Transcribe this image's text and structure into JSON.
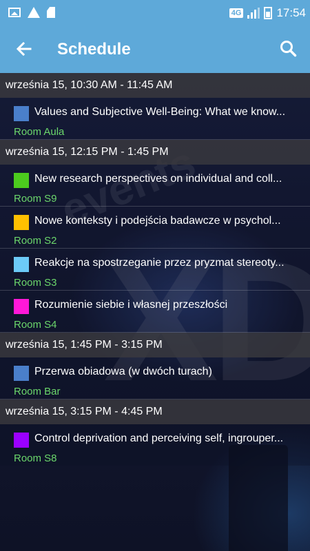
{
  "status_bar": {
    "network": "4G",
    "time": "17:54",
    "left_icons": [
      "image-icon",
      "warning-icon",
      "sd-card-icon"
    ]
  },
  "toolbar": {
    "title": "Schedule",
    "back_icon": "arrow-left-icon",
    "search_icon": "search-icon"
  },
  "colors": {
    "bar": "#5ea9d9",
    "room_text": "#6bd66b"
  },
  "background_watermark": [
    "events",
    "XD"
  ],
  "groups": [
    {
      "time": "września 15, 10:30 AM - 11:45 AM",
      "sessions": [
        {
          "title": "Values and Subjective Well-Being: What we know...",
          "room": "Room Aula",
          "color": "#4a7fcb"
        }
      ]
    },
    {
      "time": "września 15, 12:15 PM - 1:45 PM",
      "sessions": [
        {
          "title": "New research perspectives on individual and coll...",
          "room": "Room S9",
          "color": "#4ccb1e"
        },
        {
          "title": "Nowe konteksty i podejścia badawcze w psychol...",
          "room": "Room S2",
          "color": "#ffc000"
        },
        {
          "title": "Reakcje na spostrzeganie przez pryzmat stereoty...",
          "room": "Room S3",
          "color": "#6ccaf7"
        },
        {
          "title": "Rozumienie siebie i własnej przeszłości",
          "room": "Room S4",
          "color": "#ff18d8"
        }
      ]
    },
    {
      "time": "września 15, 1:45 PM - 3:15 PM",
      "sessions": [
        {
          "title": "Przerwa obiadowa (w dwóch turach)",
          "room": "Room Bar",
          "color": "#4a7fcb"
        }
      ]
    },
    {
      "time": "września 15, 3:15 PM - 4:45 PM",
      "sessions": [
        {
          "title": "Control deprivation and perceiving self, ingrouper...",
          "room": "Room S8",
          "color": "#9b00ff"
        }
      ]
    }
  ]
}
